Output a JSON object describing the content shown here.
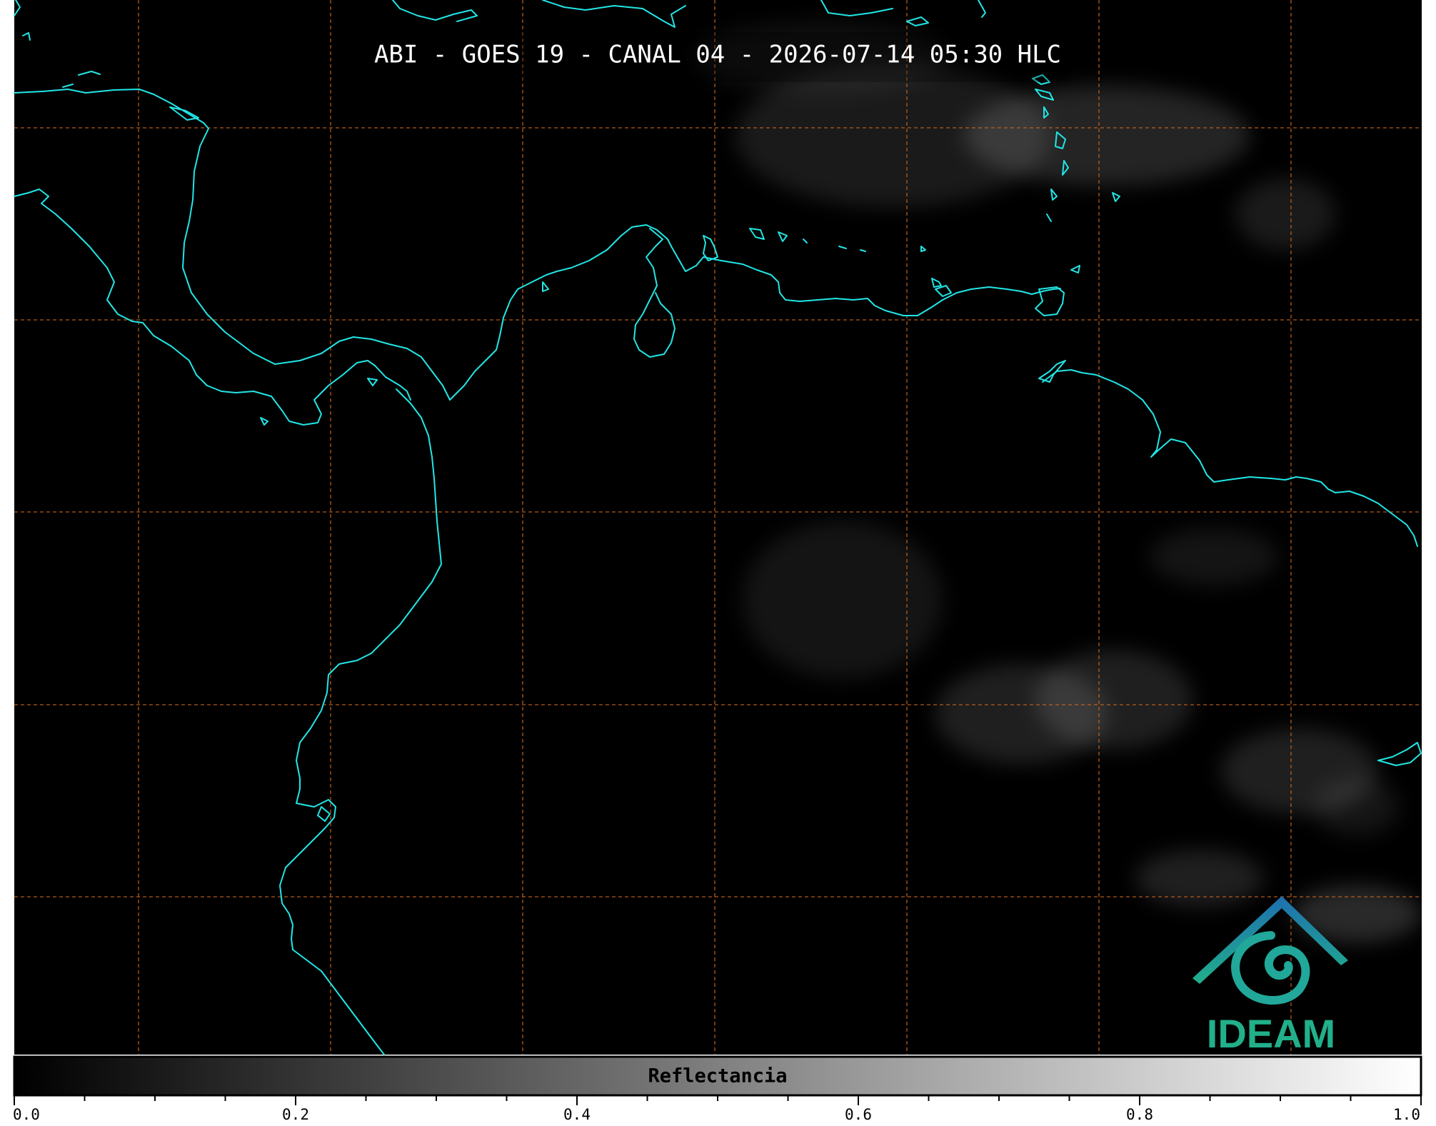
{
  "title": "ABI - GOES 19 - CANAL 04 - 2026-07-14 05:30 HLC",
  "colorbar": {
    "label": "Reflectancia",
    "ticks": [
      "0.0",
      "0.2",
      "0.4",
      "0.6",
      "0.8",
      "1.0"
    ],
    "range": [
      0.0,
      1.0
    ],
    "colormap": [
      "#000000",
      "#ffffff"
    ]
  },
  "logo": {
    "text": "IDEAM",
    "colors": [
      "#1e6fb0",
      "#21b08a"
    ]
  },
  "colors": {
    "coastline": "#22e6e6",
    "graticule": "#d2691e",
    "background": "#000000"
  }
}
